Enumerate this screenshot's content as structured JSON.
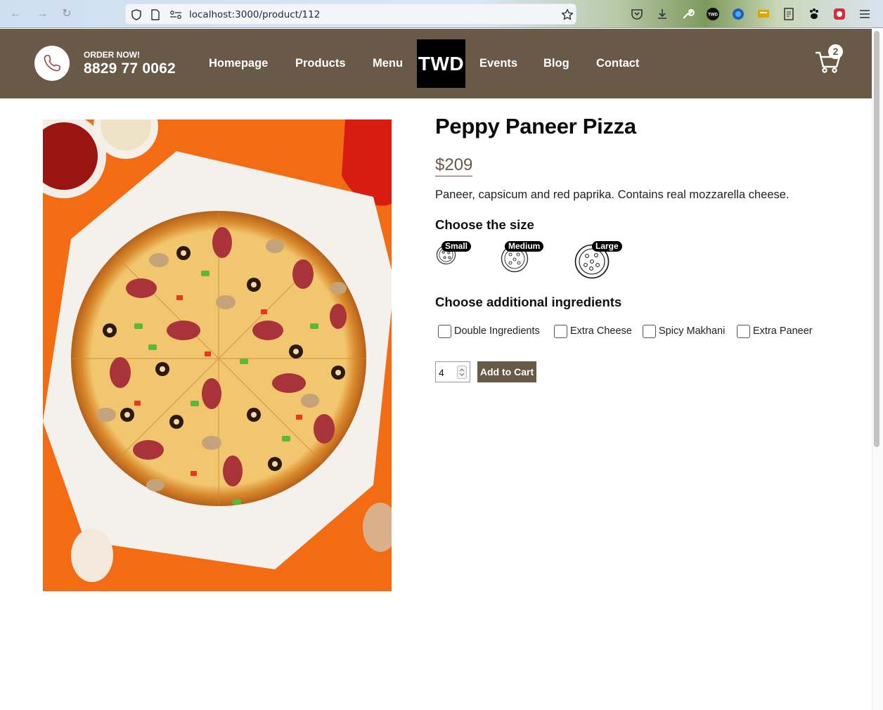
{
  "browser": {
    "url": "localhost:3000/product/112",
    "icons": [
      "back-icon",
      "forward-icon",
      "reload-icon",
      "shield-icon",
      "page-icon",
      "permissions-icon",
      "bookmark-star-icon",
      "pocket-icon",
      "download-icon",
      "wrench-icon",
      "twd-extension-icon",
      "globe-extension-icon",
      "screen-extension-icon",
      "notes-extension-icon",
      "paw-extension-icon",
      "red-extension-icon",
      "hamburger-menu-icon"
    ]
  },
  "header": {
    "order_label": "ORDER NOW!",
    "phone": "8829 77 0062",
    "nav": [
      "Homepage",
      "Products",
      "Menu",
      "Events",
      "Blog",
      "Contact"
    ],
    "logo": "TWD",
    "cart_count": "2",
    "colors": {
      "brand": "#695a48",
      "text": "#ffffff"
    }
  },
  "product": {
    "image_alt": "pizza",
    "title": "Peppy Paneer Pizza",
    "price": "$209",
    "description": "Paneer, capsicum and red paprika. Contains real mozzarella cheese.",
    "size_heading": "Choose the size",
    "sizes": [
      "Small",
      "Medium",
      "Large"
    ],
    "ingredients_heading": "Choose additional ingredients",
    "ingredients": [
      "Double Ingredients",
      "Extra Cheese",
      "Spicy Makhani",
      "Extra Paneer"
    ],
    "quantity": "4",
    "add_to_cart": "Add to Cart"
  }
}
